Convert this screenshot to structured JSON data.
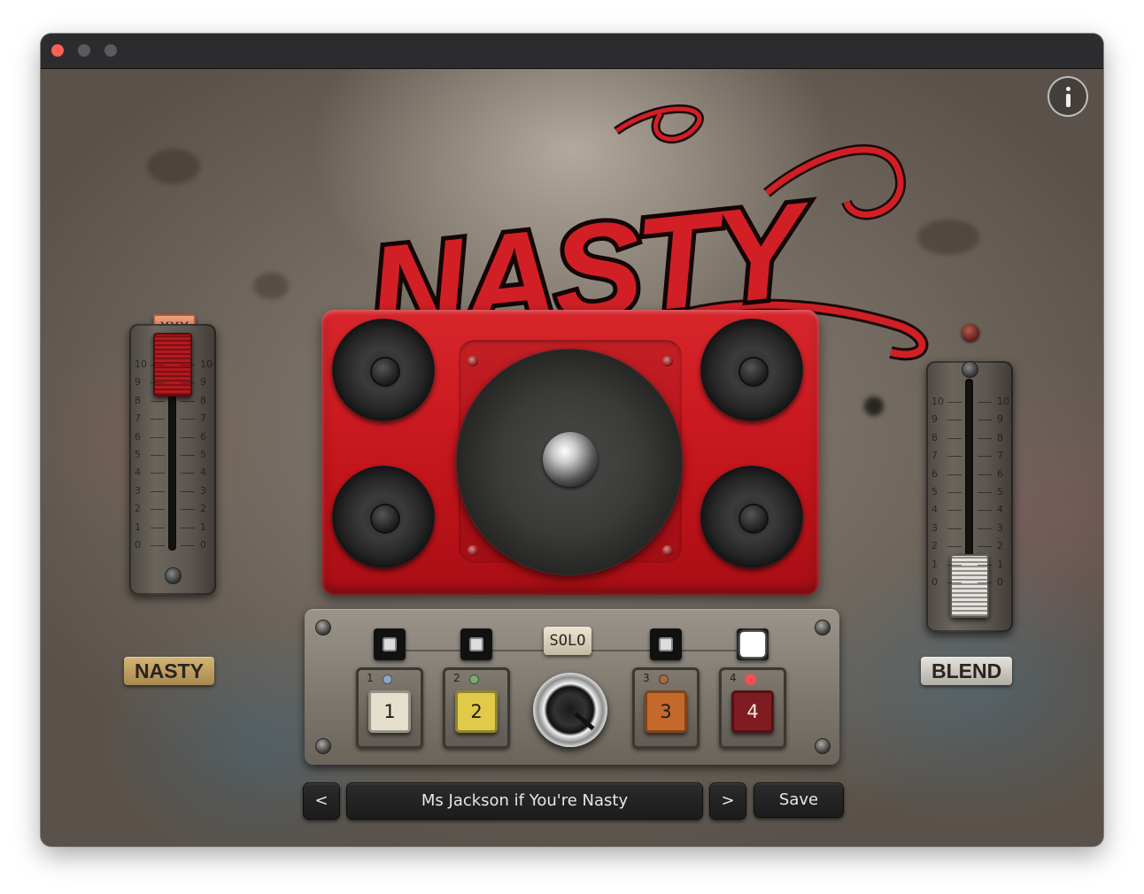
{
  "window": {
    "title": ""
  },
  "header": {
    "info_icon": "info-icon"
  },
  "logo": {
    "text": "NASTY",
    "color": "#d21f26"
  },
  "left_fader": {
    "label": "NASTY",
    "toggle_label": "XXX",
    "scale": [
      "10",
      "9",
      "8",
      "7",
      "6",
      "5",
      "4",
      "3",
      "2",
      "1",
      "0"
    ],
    "value": 10
  },
  "right_fader": {
    "label": "BLEND",
    "scale": [
      "10",
      "9",
      "8",
      "7",
      "6",
      "5",
      "4",
      "3",
      "2",
      "1",
      "0"
    ],
    "value": 0
  },
  "panel": {
    "solo_label": "SOLO",
    "bands": [
      {
        "number": "1",
        "key_label": "1",
        "key_color": "#e6dfcd",
        "led_color": "#8fa7c2",
        "toggle_on": false
      },
      {
        "number": "2",
        "key_label": "2",
        "key_color": "#e1c94a",
        "led_color": "#7cab6c",
        "toggle_on": false
      },
      {
        "number": "3",
        "key_label": "3",
        "key_color": "#c4692b",
        "led_color": "#a56b42",
        "toggle_on": false
      },
      {
        "number": "4",
        "key_label": "4",
        "key_color": "#7e1c22",
        "led_color": "#ff4d4d",
        "toggle_on": true
      }
    ]
  },
  "preset_bar": {
    "prev_label": "<",
    "preset_name": "Ms Jackson if You're Nasty",
    "next_label": ">",
    "save_label": "Save"
  }
}
